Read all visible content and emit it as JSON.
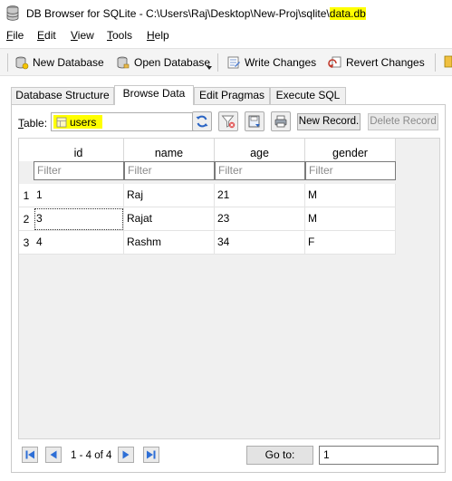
{
  "window": {
    "title_prefix": "DB Browser for SQLite - C:\\Users\\Raj\\Desktop\\New-Proj\\sqlite\\",
    "title_file": "data.db"
  },
  "menu": [
    {
      "label_u": "F",
      "label_rest": "ile"
    },
    {
      "label_u": "E",
      "label_rest": "dit"
    },
    {
      "label_u": "V",
      "label_rest": "iew"
    },
    {
      "label_u": "T",
      "label_rest": "ools"
    },
    {
      "label_u": "H",
      "label_rest": "elp"
    }
  ],
  "toolbar": {
    "new_database": "New Database",
    "open_database": "Open Database",
    "write_changes": "Write Changes",
    "revert_changes": "Revert Changes"
  },
  "tabs": [
    {
      "label": "Database Structure"
    },
    {
      "label": "Browse Data"
    },
    {
      "label": "Edit Pragmas"
    },
    {
      "label": "Execute SQL"
    }
  ],
  "active_tab": "Browse Data",
  "browse": {
    "table_label_u": "T",
    "table_label_rest": "able:",
    "selected_table": "users",
    "new_record": "New Record.",
    "delete_record": "Delete Record"
  },
  "grid": {
    "columns": [
      "id",
      "name",
      "age",
      "gender"
    ],
    "filter_placeholder": "Filter",
    "rows": [
      {
        "num": "1",
        "cells": [
          "1",
          "Raj",
          "21",
          "M"
        ]
      },
      {
        "num": "2",
        "cells": [
          "3",
          "Rajat",
          "23",
          "M"
        ]
      },
      {
        "num": "3",
        "cells": [
          "4",
          "Rashm",
          "34",
          "F"
        ]
      }
    ]
  },
  "pager": {
    "info": "1 - 4 of 4",
    "goto_label": "Go to:",
    "goto_value": "1"
  },
  "colors": {
    "highlight": "#ffff00",
    "nav_blue": "#2e6fd6"
  }
}
